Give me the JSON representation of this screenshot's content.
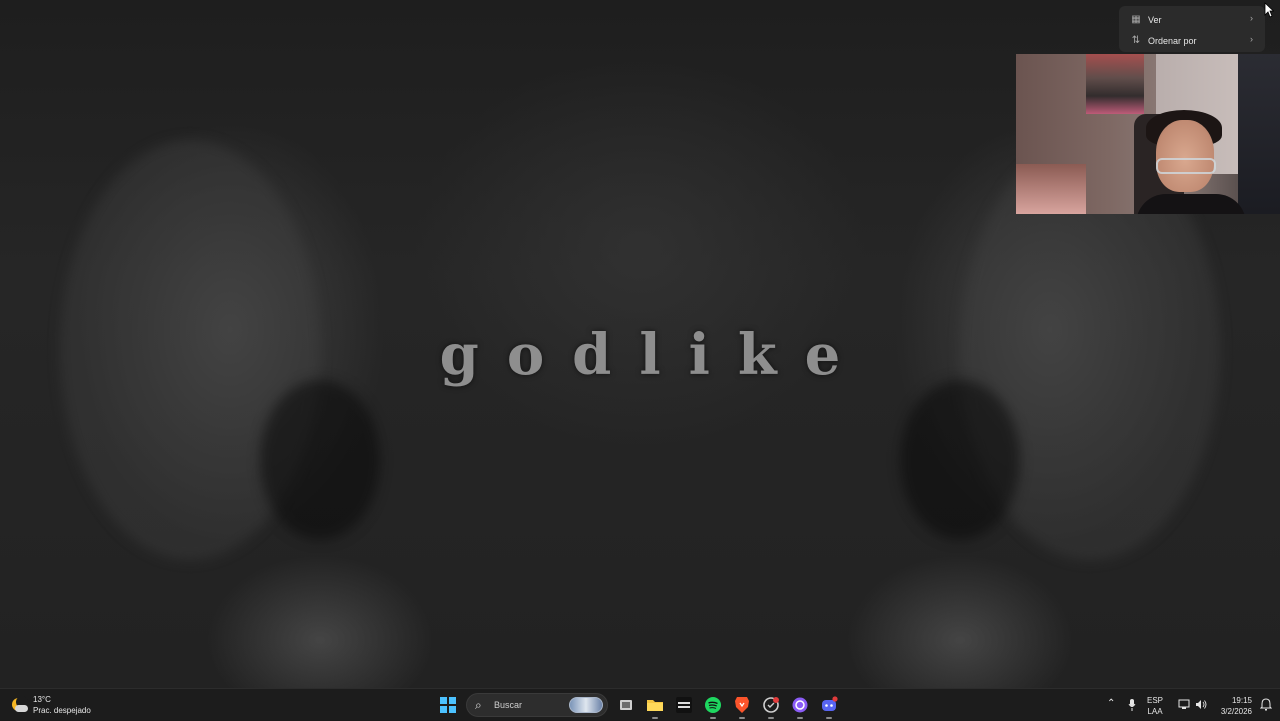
{
  "wallpaper": {
    "title_text": "godlike"
  },
  "context_menu": {
    "items": [
      {
        "label": "Ver",
        "icon": "grid-view-icon"
      },
      {
        "label": "Ordenar por",
        "icon": "sort-icon"
      }
    ]
  },
  "taskbar": {
    "weather": {
      "temperature": "13°C",
      "condition": "Prac. despejado",
      "icon": "partly-cloudy-night-icon"
    },
    "search": {
      "placeholder": "Buscar"
    },
    "apps": [
      {
        "name": "start",
        "icon": "windows-logo-icon"
      },
      {
        "name": "task-view",
        "icon": "task-view-icon"
      },
      {
        "name": "file-explorer",
        "icon": "folder-icon"
      },
      {
        "name": "call-of-duty",
        "icon": "cod-icon"
      },
      {
        "name": "spotify",
        "icon": "spotify-icon"
      },
      {
        "name": "brave",
        "icon": "brave-icon"
      },
      {
        "name": "app-circle",
        "icon": "app-icon"
      },
      {
        "name": "purple-app",
        "icon": "purple-circle-icon"
      },
      {
        "name": "discord",
        "icon": "discord-icon"
      }
    ],
    "tray": {
      "language_top": "ESP",
      "language_bottom": "LAA",
      "time": "19:15",
      "date": "3/2/2026"
    }
  },
  "colors": {
    "accent": "#4cc2ff",
    "spotify": "#1ed760",
    "brave": "#fb542b",
    "discord": "#5865f2",
    "purple": "#8b5cf6"
  }
}
